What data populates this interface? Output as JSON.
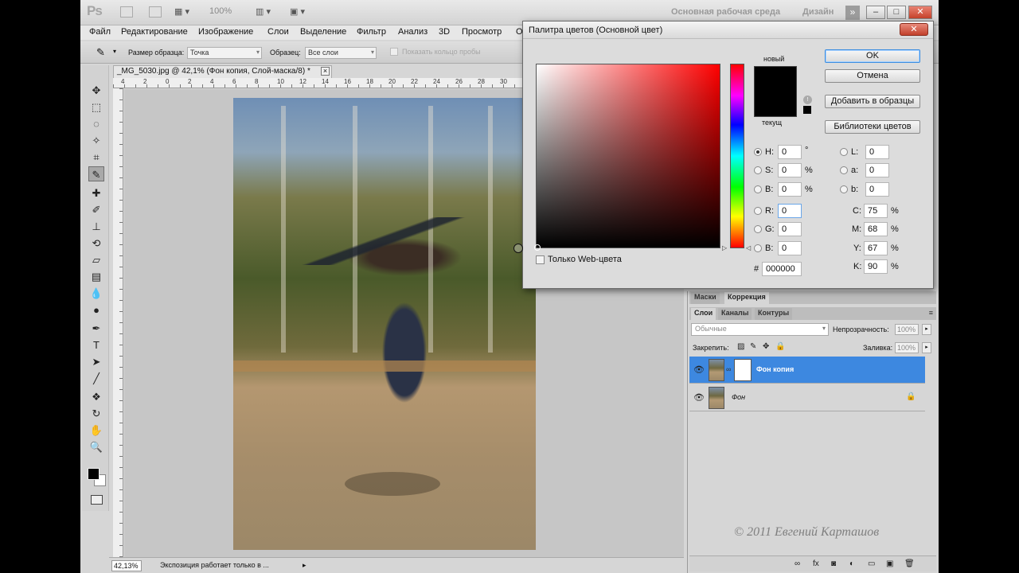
{
  "app": {
    "logo": "Ps",
    "zoom": "100%",
    "workspace": "Основная рабочая среда",
    "design": "Дизайн",
    "ws_arrows": "»"
  },
  "menu": [
    "Файл",
    "Редактирование",
    "Изображение",
    "Слои",
    "Выделение",
    "Фильтр",
    "Анализ",
    "3D",
    "Просмотр",
    "О"
  ],
  "options": {
    "sample_size_label": "Размер образца:",
    "sample_size_value": "Точка",
    "sample_label": "Образец:",
    "sample_value": "Все слои",
    "show_ring": "Показать кольцо пробы"
  },
  "document": {
    "tab_title": "_MG_5030.jpg @ 42,1% (Фон копия, Слой-маска/8) *",
    "close": "×",
    "ruler_numbers": [
      "4",
      "2",
      "0",
      "2",
      "4",
      "6",
      "8",
      "10",
      "12",
      "14",
      "16",
      "18",
      "20",
      "22",
      "24",
      "26",
      "28",
      "30"
    ]
  },
  "status": {
    "zoom": "42,13%",
    "text": "Экспозиция работает только в ...",
    "arrow": "▸"
  },
  "picker": {
    "title": "Палитра цветов (Основной цвет)",
    "close": "✕",
    "new_label": "новый",
    "current_label": "текущ",
    "ok": "OK",
    "cancel": "Отмена",
    "add_swatches": "Добавить в образцы",
    "libraries": "Библиотеки цветов",
    "fields": {
      "H": "0",
      "S": "0",
      "B": "0",
      "R": "0",
      "G": "0",
      "Bl": "0",
      "L": "0",
      "a": "0",
      "b": "0",
      "C": "75",
      "M": "68",
      "Y": "67",
      "K": "90"
    },
    "labels": {
      "H": "H:",
      "S": "S:",
      "B": "B:",
      "R": "R:",
      "G": "G:",
      "Bl": "B:",
      "L": "L:",
      "a": "a:",
      "b": "b:",
      "C": "C:",
      "M": "M:",
      "Y": "Y:",
      "K": "K:"
    },
    "units": {
      "deg": "°",
      "pct": "%"
    },
    "hex_label": "#",
    "hex": "000000",
    "web_only": "Только Web-цвета",
    "new_color": "#000000"
  },
  "panels": {
    "top_tabs": [
      "Маски",
      "Коррекция"
    ],
    "layer_tabs": [
      "Слои",
      "Каналы",
      "Контуры"
    ],
    "menu_icon": "≡",
    "blend_mode": "Обычные",
    "opacity_label": "Непрозрачность:",
    "opacity": "100%",
    "lock_label": "Закрепить:",
    "fill_label": "Заливка:",
    "fill": "100%",
    "layers": [
      {
        "name": "Фон копия",
        "selected": true
      },
      {
        "name": "Фон",
        "selected": false
      }
    ],
    "watermark": "© 2011 Евгений Карташов"
  }
}
